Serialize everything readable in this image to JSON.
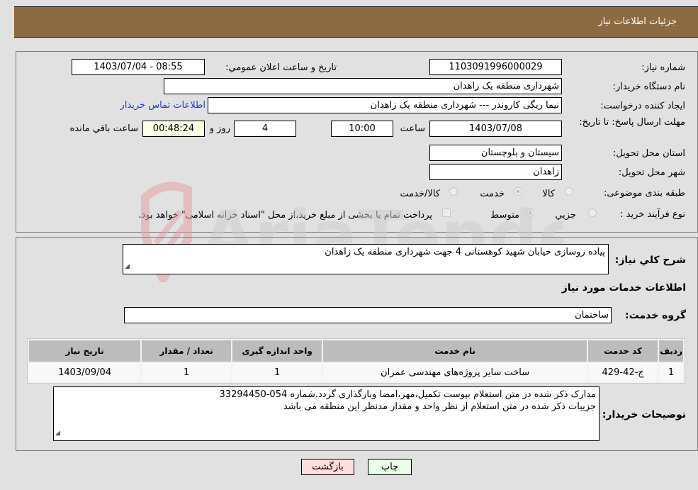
{
  "header": {
    "title": "جزئيات اطلاعات نياز"
  },
  "details": {
    "need_number_label": "شماره نیاز:",
    "need_number": "1103091996000029",
    "announce_label": "تاريخ و ساعت اعلان عمومي:",
    "announce_value": "1403/07/04 - 08:55",
    "buyer_org_label": "نام دستگاه خریدار:",
    "buyer_org": "شهرداری منطقه یک زاهدان",
    "creator_label": "ایجاد کننده درخواست:",
    "creator": "نیما ریگی کاروندر --- شهرداری منطقه یک زاهدان",
    "contact_link": "اطلاعات تماس خریدار",
    "deadline_label": "مهلت ارسال پاسخ: تا تاریخ:",
    "deadline_date": "1403/07/08",
    "time_label": "ساعت",
    "deadline_time": "10:00",
    "days_value": "4",
    "days_label": "روز و",
    "remaining_time": "00:48:24",
    "remaining_label": "ساعت باقي مانده",
    "province_label": "استان محل تحویل:",
    "province": "سیستان و بلوچستان",
    "city_label": "شهر محل تحویل:",
    "city": "زاهدان",
    "category_label": "طبقه بندی موضوعی:",
    "category_options": [
      {
        "label": "کالا",
        "checked": false
      },
      {
        "label": "خدمت",
        "checked": true
      },
      {
        "label": "کالا/خدمت",
        "checked": false
      }
    ],
    "process_label": "نوع فرآیند خرید :",
    "process_options": [
      {
        "label": "جزيي",
        "checked": false
      },
      {
        "label": "متوسط",
        "checked": true
      }
    ],
    "treasury_note": "پرداخت تمام یا بخشی از مبلغ خرید،از محل \"اسناد خزانه اسلامی\" خواهد بود."
  },
  "description": {
    "label": "شرح کلي نياز:",
    "value": "پیاده روسازی خیابان شهید کوهستانی 4 جهت شهرداری منطقه یک زاهدان"
  },
  "services": {
    "section_title": "اطلاعات خدمات مورد نياز",
    "group_label": "گروه خدمت:",
    "group_value": "ساختمان",
    "columns": [
      "ردیف",
      "کد خدمت",
      "نام خدمت",
      "واحد اندازه گیری",
      "تعداد / مقدار",
      "تاریخ نیاز"
    ],
    "rows": [
      [
        "1",
        "ج-42-429",
        "ساخت سایر پروژه‌های مهندسی عمران",
        "1",
        "1",
        "1403/09/04"
      ]
    ]
  },
  "buyer_notes": {
    "label": "توضیحات خریدار:",
    "line1": "مدارک ذکر شده در متن استعلام بپوست تکمیل،مهر،امضا وبارگذاری گردد.شماره 054-33294450",
    "line2": "جزییات ذکر شده در متن استعلام از نظر واحد و مقدار مدنظر این منطقه می باشد"
  },
  "buttons": {
    "print": "چاپ",
    "back": "بازگشت"
  },
  "watermark": {
    "text": "AriaTender.neT"
  }
}
